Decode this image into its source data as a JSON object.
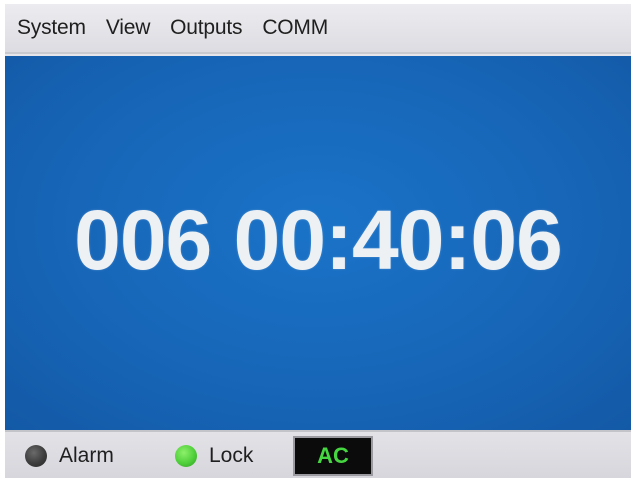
{
  "menu": {
    "items": [
      {
        "label": "System"
      },
      {
        "label": "View"
      },
      {
        "label": "Outputs"
      },
      {
        "label": "COMM"
      }
    ]
  },
  "display": {
    "time": "006 00:40:06",
    "background_color": "#1766b8",
    "text_color": "#eef1f4"
  },
  "status": {
    "alarm": {
      "label": "Alarm",
      "state": "off",
      "led_color": "#3d3d3d"
    },
    "lock": {
      "label": "Lock",
      "state": "on",
      "led_color": "#4fcf3a"
    },
    "power": {
      "label": "AC",
      "text_color": "#46d641",
      "background_color": "#0b0b0b"
    }
  }
}
